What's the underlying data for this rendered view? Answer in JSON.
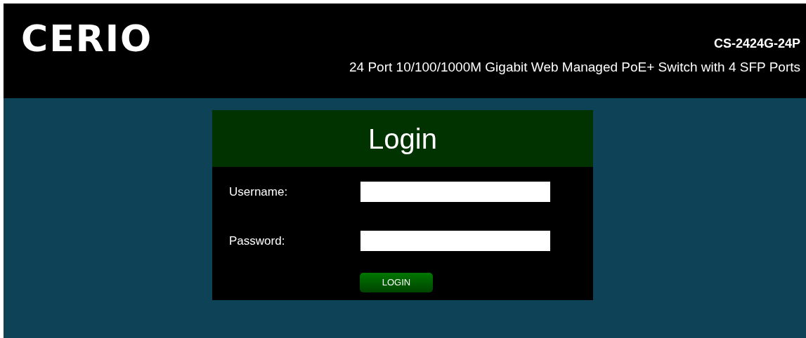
{
  "header": {
    "logo": "CERIO",
    "model": "CS-2424G-24P",
    "description": "24 Port 10/100/1000M Gigabit Web Managed PoE+ Switch with 4 SFP Ports"
  },
  "login": {
    "title": "Login",
    "fields": [
      {
        "label": "Username:"
      },
      {
        "label": "Password:"
      }
    ],
    "button": "LOGIN"
  }
}
